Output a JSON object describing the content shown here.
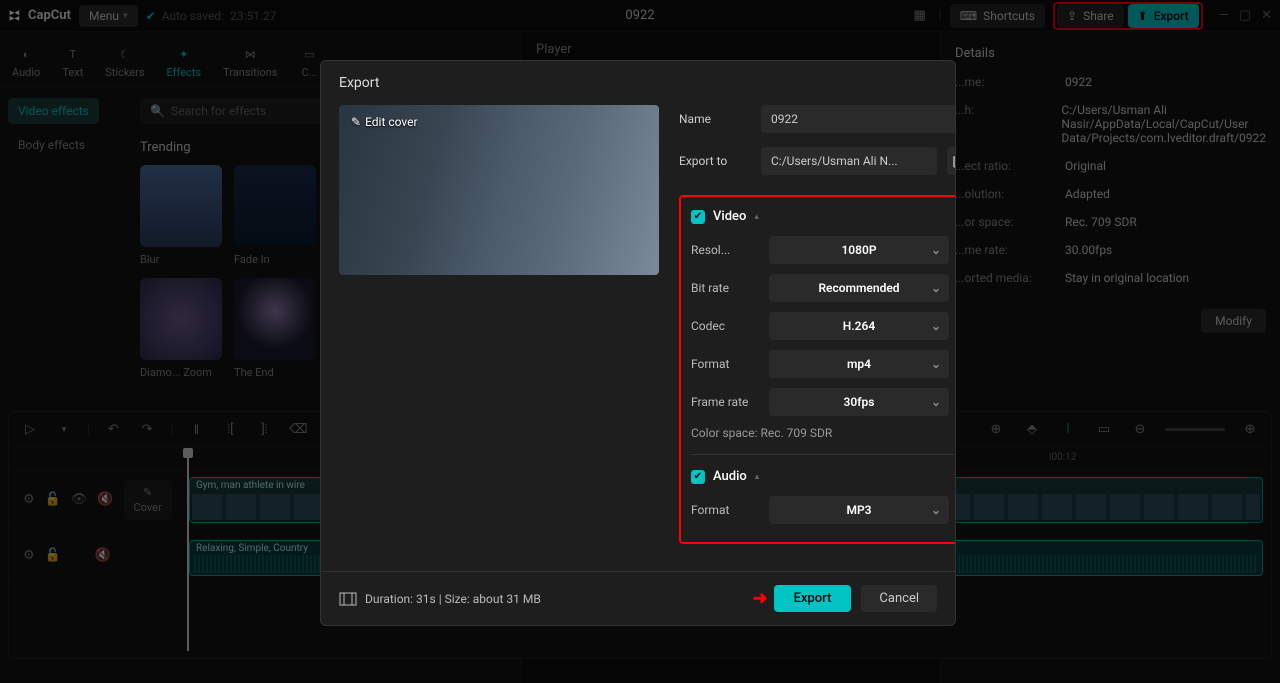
{
  "app": {
    "name": "CapCut",
    "menu": "Menu",
    "autosave_label": "Auto saved:",
    "autosave_time": "23:51:27",
    "project_title": "0922"
  },
  "topbar": {
    "shortcuts": "Shortcuts",
    "share": "Share",
    "export": "Export"
  },
  "tabs": [
    "Audio",
    "Text",
    "Stickers",
    "Effects",
    "Transitions",
    "C..."
  ],
  "effects_sidebar": {
    "video": "Video effects",
    "body": "Body effects"
  },
  "search_placeholder": "Search for effects",
  "trending_title": "Trending",
  "effects": [
    "Blur",
    "Fade In",
    "Diamo... Zoom",
    "The End"
  ],
  "center_header": "Player",
  "details": {
    "header": "Details",
    "rows": [
      {
        "label": "...me:",
        "value": "0922"
      },
      {
        "label": "...h:",
        "value": "C:/Users/Usman Ali Nasir/AppData/Local/CapCut/User Data/Projects/com.lveditor.draft/0922"
      },
      {
        "label": "...ect ratio:",
        "value": "Original"
      },
      {
        "label": "...olution:",
        "value": "Adapted"
      },
      {
        "label": "...or space:",
        "value": "Rec. 709 SDR"
      },
      {
        "label": "...me rate:",
        "value": "30.00fps"
      },
      {
        "label": "...orted media:",
        "value": "Stay in original location"
      }
    ],
    "modify": "Modify"
  },
  "timeline": {
    "ticks": [
      "|00:12"
    ],
    "cover": "Cover",
    "video_clip": "Gym, man athlete in wire",
    "audio_clip": "Relaxing, Simple, Country"
  },
  "modal": {
    "title": "Export",
    "edit_cover": "Edit cover",
    "name_label": "Name",
    "name_value": "0922",
    "exportto_label": "Export to",
    "exportto_value": "C:/Users/Usman Ali N...",
    "video_section": "Video",
    "audio_section": "Audio",
    "resolution_label": "Resol...",
    "resolution_value": "1080P",
    "bitrate_label": "Bit rate",
    "bitrate_value": "Recommended",
    "codec_label": "Codec",
    "codec_value": "H.264",
    "format_label": "Format",
    "format_value": "mp4",
    "framerate_label": "Frame rate",
    "framerate_value": "30fps",
    "colorspace": "Color space: Rec. 709 SDR",
    "audio_format_label": "Format",
    "audio_format_value": "MP3",
    "duration_info": "Duration: 31s | Size: about 31 MB",
    "export_btn": "Export",
    "cancel_btn": "Cancel"
  }
}
